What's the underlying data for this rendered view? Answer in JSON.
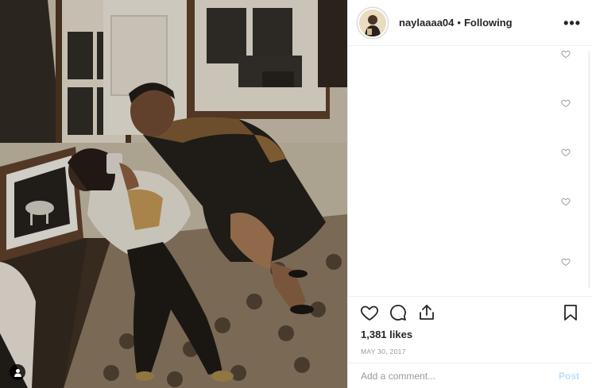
{
  "header": {
    "username": "naylaaaa04",
    "separator": "•",
    "follow_status": "Following",
    "more_label": "•••"
  },
  "comments": {
    "like_icons": [
      "heart-outline-icon",
      "heart-outline-icon",
      "heart-outline-icon",
      "heart-outline-icon",
      "heart-outline-icon"
    ]
  },
  "actions": {
    "like_icon": "heart-outline-icon",
    "comment_icon": "speech-bubble-icon",
    "share_icon": "share-arrow-icon",
    "save_icon": "bookmark-icon"
  },
  "likes": "1,381 likes",
  "date": "MAY 30, 2017",
  "comment_input": {
    "placeholder": "Add a comment...",
    "value": ""
  },
  "post_button": "Post",
  "photo": {
    "tag_icon": "user-tag-icon"
  },
  "colors": {
    "border": "#efefef",
    "text": "#262626",
    "muted": "#999999",
    "post_disabled": "#b9dffc"
  }
}
